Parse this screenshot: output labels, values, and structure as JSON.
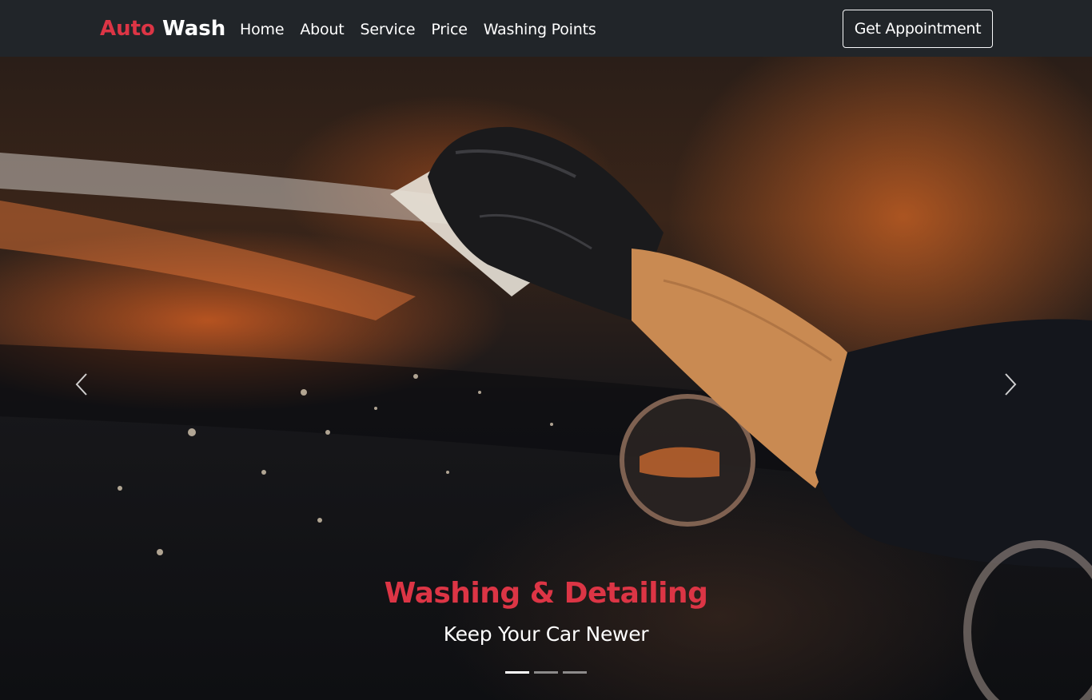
{
  "navbar": {
    "brand_part1": "Auto",
    "brand_part2": "Wash",
    "links": [
      "Home",
      "About",
      "Service",
      "Price",
      "Washing Points"
    ],
    "cta_label": "Get Appointment"
  },
  "carousel": {
    "slide_title": "Washing & Detailing",
    "slide_subtitle": "Keep Your Car Newer",
    "indicator_count": 3,
    "active_indicator": 1,
    "prev_icon": "chevron-left-icon",
    "next_icon": "chevron-right-icon"
  },
  "colors": {
    "accent": "#dc3545",
    "navbar_bg": "#212529",
    "text_light": "#ffffff"
  }
}
